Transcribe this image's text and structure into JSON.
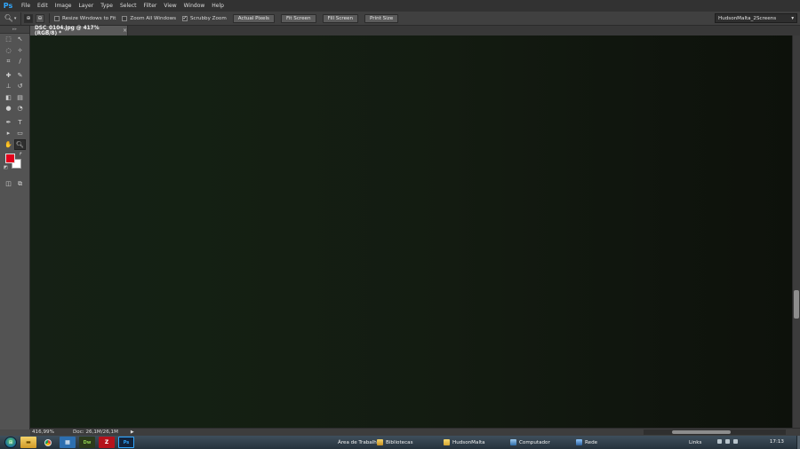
{
  "app": {
    "logo": "Ps"
  },
  "menu": [
    "File",
    "Edit",
    "Image",
    "Layer",
    "Type",
    "Select",
    "Filter",
    "View",
    "Window",
    "Help"
  ],
  "options": {
    "tool_icon": "zoom-icon",
    "zoom_in_icon": "⊕",
    "zoom_out_icon": "⊖",
    "checkboxes": [
      {
        "label": "Resize Windows to Fit",
        "checked": false
      },
      {
        "label": "Zoom All Windows",
        "checked": false
      },
      {
        "label": "Scrubby Zoom",
        "checked": true
      }
    ],
    "buttons": [
      "Actual Pixels",
      "Fit Screen",
      "Fill Screen",
      "Print Size"
    ],
    "workspace": "HudsonMalta_2Screens"
  },
  "document_tab": {
    "title": "DSC_0104.jpg @ 417% (RGB/8) *",
    "close": "×"
  },
  "colors": {
    "foreground": "#e3001b",
    "background": "#ffffff"
  },
  "status": {
    "zoom": "416,99%",
    "doc": "Doc: 26,1M/26,1M",
    "arrow": "▶"
  },
  "taskbar": {
    "items": [
      {
        "label": "Área de Trabalho",
        "icon": "none"
      },
      {
        "label": "Bibliotecas",
        "icon": "library-icon"
      },
      {
        "label": "HudsonMalta",
        "icon": "folder-icon"
      },
      {
        "label": "Computador",
        "icon": "computer-icon"
      },
      {
        "label": "Rede",
        "icon": "network-icon"
      }
    ],
    "links": "Links",
    "clock": "17:13"
  }
}
